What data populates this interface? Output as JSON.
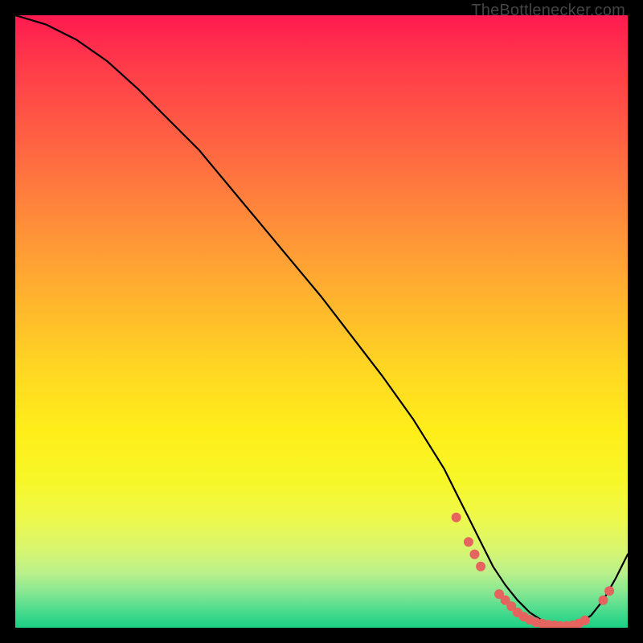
{
  "watermark": "TheBottlenecker.com",
  "chart_data": {
    "type": "line",
    "title": "",
    "xlabel": "",
    "ylabel": "",
    "xlim": [
      0,
      100
    ],
    "ylim": [
      0,
      100
    ],
    "series": [
      {
        "name": "curve",
        "x": [
          0,
          5,
          10,
          15,
          20,
          30,
          40,
          50,
          60,
          65,
          70,
          72,
          74,
          76,
          78,
          80,
          82,
          84,
          86,
          88,
          90,
          92,
          94,
          96,
          98,
          100
        ],
        "y": [
          100,
          98.5,
          96,
          92.5,
          88,
          78,
          66,
          54,
          41,
          34,
          26,
          22,
          18,
          14,
          10,
          7,
          4.5,
          2.5,
          1.2,
          0.5,
          0.3,
          0.7,
          2,
          4.5,
          8,
          12
        ]
      }
    ],
    "markers": [
      {
        "x": 72,
        "y": 18
      },
      {
        "x": 74,
        "y": 14
      },
      {
        "x": 75,
        "y": 12
      },
      {
        "x": 76,
        "y": 10
      },
      {
        "x": 79,
        "y": 5.5
      },
      {
        "x": 80,
        "y": 4.5
      },
      {
        "x": 81,
        "y": 3.5
      },
      {
        "x": 82,
        "y": 2.5
      },
      {
        "x": 83,
        "y": 1.8
      },
      {
        "x": 84,
        "y": 1.3
      },
      {
        "x": 85,
        "y": 0.9
      },
      {
        "x": 86,
        "y": 0.7
      },
      {
        "x": 87,
        "y": 0.5
      },
      {
        "x": 88,
        "y": 0.4
      },
      {
        "x": 89,
        "y": 0.3
      },
      {
        "x": 90,
        "y": 0.3
      },
      {
        "x": 91,
        "y": 0.4
      },
      {
        "x": 92,
        "y": 0.7
      },
      {
        "x": 93,
        "y": 1.2
      },
      {
        "x": 96,
        "y": 4.5
      },
      {
        "x": 97,
        "y": 6
      }
    ]
  }
}
